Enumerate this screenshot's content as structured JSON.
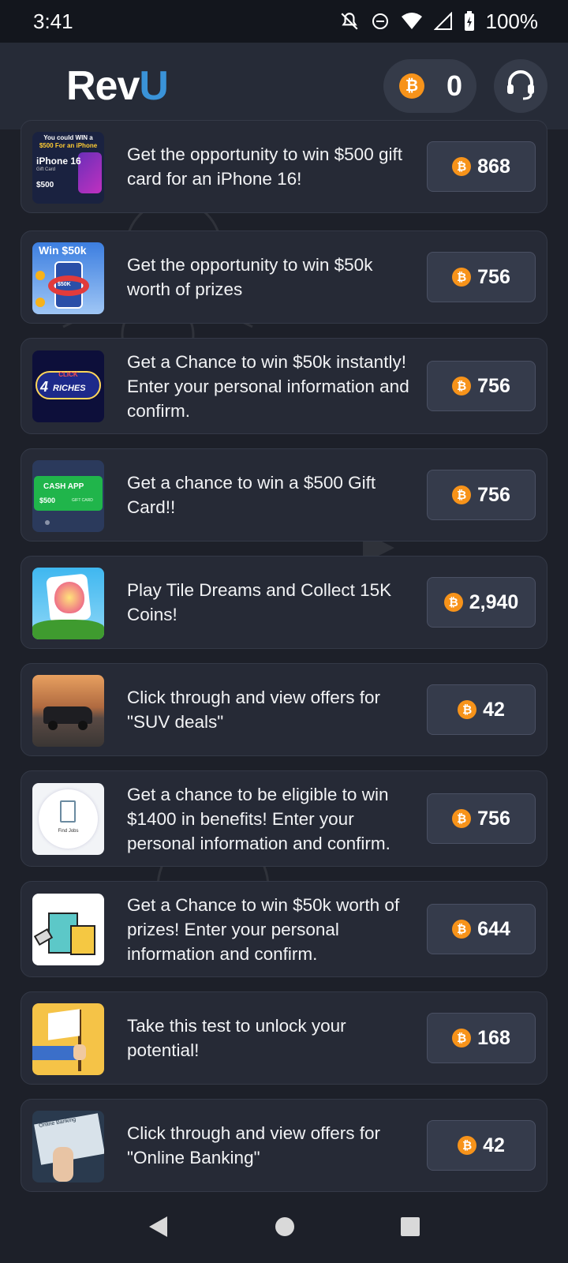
{
  "status_bar": {
    "time": "3:41",
    "battery": "100%"
  },
  "header": {
    "logo_part1": "Rev",
    "logo_part2": "U",
    "coin_balance": "0"
  },
  "colors": {
    "coin": "#f7931a",
    "brand_blue": "#3a93d8",
    "card_bg": "#262a36",
    "page_bg": "#1d2029"
  },
  "offers": [
    {
      "text": "Get the opportunity to win $500 gift card for an iPhone 16!",
      "reward": "868",
      "thumb": {
        "icon": "iphone-giftcard-icon",
        "line1": "You could WIN a",
        "line2": "$500 For an iPhone",
        "line3": "iPhone 16",
        "line4": "Gift Card",
        "line5": "$500"
      }
    },
    {
      "text": "Get the opportunity to win $50k worth of prizes",
      "reward": "756",
      "thumb": {
        "icon": "win-50k-icon",
        "line1": "Win $50k",
        "line2": "$50K"
      }
    },
    {
      "text": "Get a Chance to win $50k instantly! Enter your personal information and confirm.",
      "reward": "756",
      "thumb": {
        "icon": "click4riches-icon",
        "line1": "CLICK",
        "line2": "4",
        "line3": "RICHES"
      }
    },
    {
      "text": "Get a chance to win a $500 Gift Card!!",
      "reward": "756",
      "thumb": {
        "icon": "cash-app-card-icon",
        "line1": "CASH APP",
        "line2": "$500",
        "line3": "GIFT CARD"
      }
    },
    {
      "text": "Play Tile Dreams and Collect 15K Coins!",
      "reward": "2,940",
      "thumb": {
        "icon": "tile-dreams-icon"
      }
    },
    {
      "text": "Click through and view offers for \"SUV deals\"",
      "reward": "42",
      "thumb": {
        "icon": "suv-photo-icon"
      }
    },
    {
      "text": "Get a chance to be eligible to win $1400 in benefits! Enter your personal information and confirm.",
      "reward": "756",
      "thumb": {
        "icon": "find-jobs-icon",
        "line1": "Find Jobs"
      }
    },
    {
      "text": "Get a Chance to win $50k worth of prizes! Enter your personal information and confirm.",
      "reward": "644",
      "thumb": {
        "icon": "shopping-bags-icon"
      }
    },
    {
      "text": "Take this test to unlock your potential!",
      "reward": "168",
      "thumb": {
        "icon": "white-flag-icon"
      }
    },
    {
      "text": "Click through and view offers for \"Online Banking\"",
      "reward": "42",
      "thumb": {
        "icon": "online-banking-icon",
        "line1": "Online Banking"
      }
    }
  ]
}
